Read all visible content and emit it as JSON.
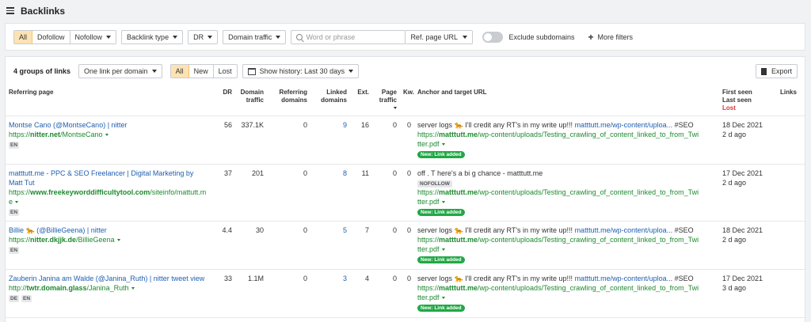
{
  "header": {
    "title": "Backlinks"
  },
  "filters": {
    "link_types": [
      "All",
      "Dofollow",
      "Nofollow"
    ],
    "backlink_type": "Backlink type",
    "dr": "DR",
    "domain_traffic": "Domain traffic",
    "search_placeholder": "Word or phrase",
    "ref_page_url": "Ref. page URL",
    "exclude_subdomains": "Exclude subdomains",
    "more_filters": "More filters"
  },
  "toolbar": {
    "groups_count": "4 groups of links",
    "grouping": "One link per domain",
    "status_tabs": [
      "All",
      "New",
      "Lost"
    ],
    "history": "Show history: Last 30 days",
    "export": "Export"
  },
  "table": {
    "headers": {
      "referring_page": "Referring page",
      "dr": "DR",
      "domain_traffic_1": "Domain",
      "domain_traffic_2": "traffic",
      "ref_domains_1": "Referring",
      "ref_domains_2": "domains",
      "linked_domains_1": "Linked",
      "linked_domains_2": "domains",
      "ext": "Ext.",
      "page_traffic_1": "Page",
      "page_traffic_2": "traffic",
      "kw": "Kw.",
      "anchor": "Anchor and target URL",
      "first_seen": "First seen",
      "last_seen": "Last seen",
      "lost": "Lost",
      "links": "Links"
    },
    "rows": [
      {
        "title": "Montse Cano (@MontseCano) | nitter",
        "url_prefix": "https://",
        "url_domain": "nitter.net",
        "url_path": "/MontseCano",
        "langs": [
          "EN"
        ],
        "dr": "56",
        "domain_traffic": "337.1K",
        "ref_domains": "0",
        "linked_domains": "9",
        "ext": "16",
        "page_traffic": "0",
        "kw": "0",
        "anchor_text": "server logs ",
        "anchor_emoji": "🐆",
        "anchor_rest": " I'll credit any RT's in my write up!!! ",
        "anchor_link": "matttutt.me/wp-content/uploa...",
        "anchor_tail": " #SEO",
        "target_prefix": "https://",
        "target_domain": "matttutt.me",
        "target_path": "/wp-content/uploads/Testing_crawling_of_content_linked_to_from_Twi",
        "target_path2": "tter.pdf",
        "badge": "New: Link added",
        "first_seen": "18 Dec 2021",
        "last_seen": "2 d ago"
      },
      {
        "title": "matttutt.me - PPC & SEO Freelancer | Digital Marketing by Matt Tut",
        "url_prefix": "https://",
        "url_domain": "www.freekeyworddifficultytool.com",
        "url_path": "/siteinfo/mattutt.me",
        "langs": [
          "EN"
        ],
        "dr": "37",
        "domain_traffic": "201",
        "ref_domains": "0",
        "linked_domains": "8",
        "ext": "11",
        "page_traffic": "0",
        "kw": "0",
        "anchor_text": "off . T here's a bi g chance - matttutt.me",
        "nofollow": "NOFOLLOW",
        "target_prefix": "https://",
        "target_domain": "matttutt.me",
        "target_path": "/wp-content/uploads/Testing_crawling_of_content_linked_to_from_Twi",
        "target_path2": "tter.pdf",
        "badge": "New: Link added",
        "first_seen": "17 Dec 2021",
        "last_seen": "2 d ago"
      },
      {
        "title": "Billie ",
        "title_emoji": "🐆",
        "title_rest": " (@BillieGeena) | nitter",
        "url_prefix": "https://",
        "url_domain": "nitter.dkjjk.de",
        "url_path": "/BillieGeena",
        "langs": [
          "EN"
        ],
        "dr": "4.4",
        "domain_traffic": "30",
        "ref_domains": "0",
        "linked_domains": "5",
        "ext": "7",
        "page_traffic": "0",
        "kw": "0",
        "anchor_text": "server logs ",
        "anchor_emoji": "🐆",
        "anchor_rest": " I'll credit any RT's in my write up!!! ",
        "anchor_link": "matttutt.me/wp-content/uploa...",
        "anchor_tail": " #SEO",
        "target_prefix": "https://",
        "target_domain": "matttutt.me",
        "target_path": "/wp-content/uploads/Testing_crawling_of_content_linked_to_from_Twi",
        "target_path2": "tter.pdf",
        "badge": "New: Link added",
        "first_seen": "18 Dec 2021",
        "last_seen": "2 d ago"
      },
      {
        "title": "Zauberin Janina am Walde (@Janina_Ruth) | nitter tweet view",
        "url_prefix": "http://",
        "url_domain": "twtr.domain.glass",
        "url_path": "/Janina_Ruth",
        "langs": [
          "DE",
          "EN"
        ],
        "dr": "33",
        "domain_traffic": "1.1M",
        "ref_domains": "0",
        "linked_domains": "3",
        "ext": "4",
        "page_traffic": "0",
        "kw": "0",
        "anchor_text": "server logs ",
        "anchor_emoji": "🐆",
        "anchor_rest": " I'll credit any RT's in my write up!!! ",
        "anchor_link": "matttutt.me/wp-content/uploa...",
        "anchor_tail": " #SEO",
        "target_prefix": "https://",
        "target_domain": "matttutt.me",
        "target_path": "/wp-content/uploads/Testing_crawling_of_content_linked_to_from_Twi",
        "target_path2": "tter.pdf",
        "badge": "New: Link added",
        "first_seen": "17 Dec 2021",
        "last_seen": "3 d ago"
      }
    ]
  }
}
